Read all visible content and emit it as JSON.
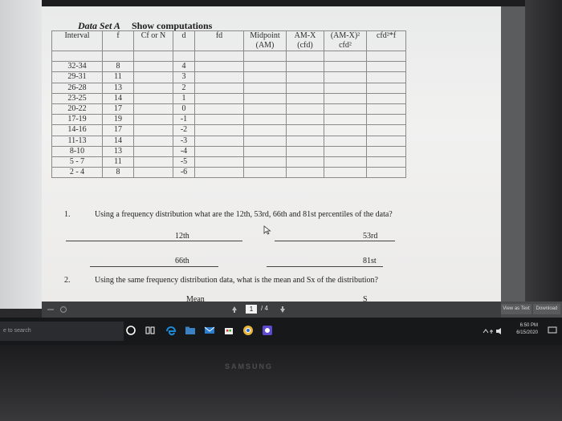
{
  "worksheet": {
    "title_italic": "Data Set A",
    "title_bold": "Show computations",
    "table": {
      "headers": {
        "interval": "Interval",
        "f": "f",
        "cf": "Cf or N",
        "d": "d",
        "fd": "fd",
        "midpoint_line1": "Midpoint",
        "midpoint_line2": "(AM)",
        "amx_line1": "AM-X",
        "amx_line2": "(cfd)",
        "amx2_line1": "(AM-X)²",
        "amx2_line2": "cfd²",
        "cfd_f": "cfd²*f"
      },
      "rows": [
        {
          "interval": "32-34",
          "f": "8",
          "d": "4"
        },
        {
          "interval": "29-31",
          "f": "11",
          "d": "3"
        },
        {
          "interval": "26-28",
          "f": "13",
          "d": "2"
        },
        {
          "interval": "23-25",
          "f": "14",
          "d": "1"
        },
        {
          "interval": "20-22",
          "f": "17",
          "d": "0"
        },
        {
          "interval": "17-19",
          "f": "19",
          "d": "-1"
        },
        {
          "interval": "14-16",
          "f": "17",
          "d": "-2"
        },
        {
          "interval": "11-13",
          "f": "14",
          "d": "-3"
        },
        {
          "interval": "8-10",
          "f": "13",
          "d": "-4"
        },
        {
          "interval": "5 - 7",
          "f": "11",
          "d": "-5"
        },
        {
          "interval": "2 - 4",
          "f": "8",
          "d": "-6"
        }
      ]
    },
    "q1": {
      "number": "1.",
      "text": "Using a frequency distribution what are the 12th, 53rd, 66th and 81st percentiles of the data?",
      "p12": "12th",
      "p53": "53rd",
      "p66": "66th",
      "p81": "81st"
    },
    "q2": {
      "number": "2.",
      "text": "Using the same frequency distribution data, what is the mean and Sx of the distribution?",
      "mean_label": "Mean",
      "s_label": "S"
    }
  },
  "pdf_toolbar": {
    "current_page": "1",
    "total_pages": "/ 4",
    "view_text_button": "View as Text",
    "download_button": "Download"
  },
  "taskbar": {
    "search_placeholder": "e to search",
    "time": "6:50 PM",
    "date": "6/15/2020"
  },
  "monitor_brand": "SAMSUNG",
  "colors": {
    "taskbar": "#17181a",
    "edge_icon": "#1e8ad6",
    "chrome_icon": "#e8b53a"
  }
}
